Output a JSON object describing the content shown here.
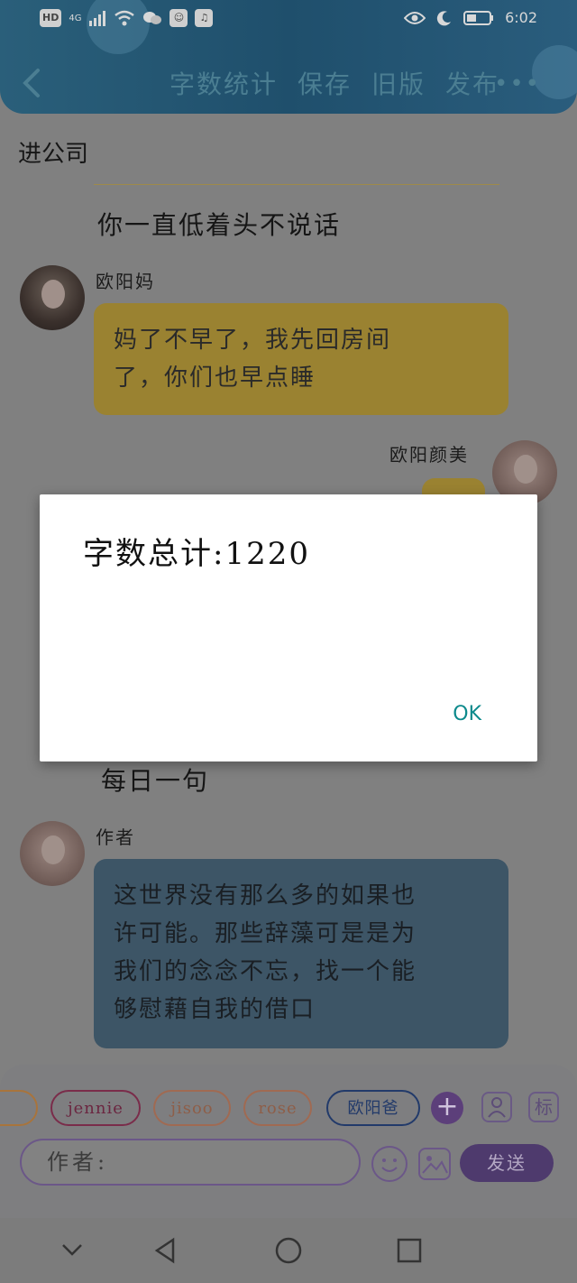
{
  "status_bar": {
    "left_badges": [
      "HD",
      "4G"
    ],
    "time": "6:02"
  },
  "header": {
    "back_icon": "chevron-left-icon",
    "actions": [
      "字数统计",
      "保存",
      "旧版",
      "发布"
    ],
    "more_icon": "more-horizontal-icon"
  },
  "content": {
    "page_title": "进公司",
    "section_1_heading": "你一直低着头不说话",
    "messages": [
      {
        "speaker": "欧阳妈",
        "text_line1": "妈了不早了，我先回房间",
        "text_line2": "了，你们也早点睡"
      },
      {
        "speaker": "欧阳颜美"
      }
    ],
    "section_2_heading": "每日一句",
    "author_label": "作者",
    "quote_line1": "这世界没有那么多的如果也",
    "quote_line2": "许可能。那些辞藻可是是为",
    "quote_line3": "我们的念念不忘，找一个能",
    "quote_line4": "够慰藉自我的借口"
  },
  "dialog": {
    "text": "字数总计:1220",
    "ok_label": "OK"
  },
  "composer": {
    "chips": [
      "jennie",
      "jisoo",
      "rose",
      "欧阳爸"
    ],
    "add_icon": "plus-icon",
    "person_icon": "person-icon",
    "tag_label": "标",
    "input_placeholder": "作者:",
    "emoji_icon": "smile-icon",
    "image_icon": "image-icon",
    "send_label": "发送"
  },
  "system_nav": {
    "icons": [
      "chevron-down-icon",
      "back-triangle-icon",
      "home-circle-icon",
      "recents-square-icon"
    ]
  },
  "colors": {
    "header_bg": "#2a5f7a",
    "accent_purple": "#6b5788",
    "dialog_ok": "#0d8a8c",
    "yellow_bubble": "#9a8231",
    "blue_bubble": "#3d5566"
  }
}
